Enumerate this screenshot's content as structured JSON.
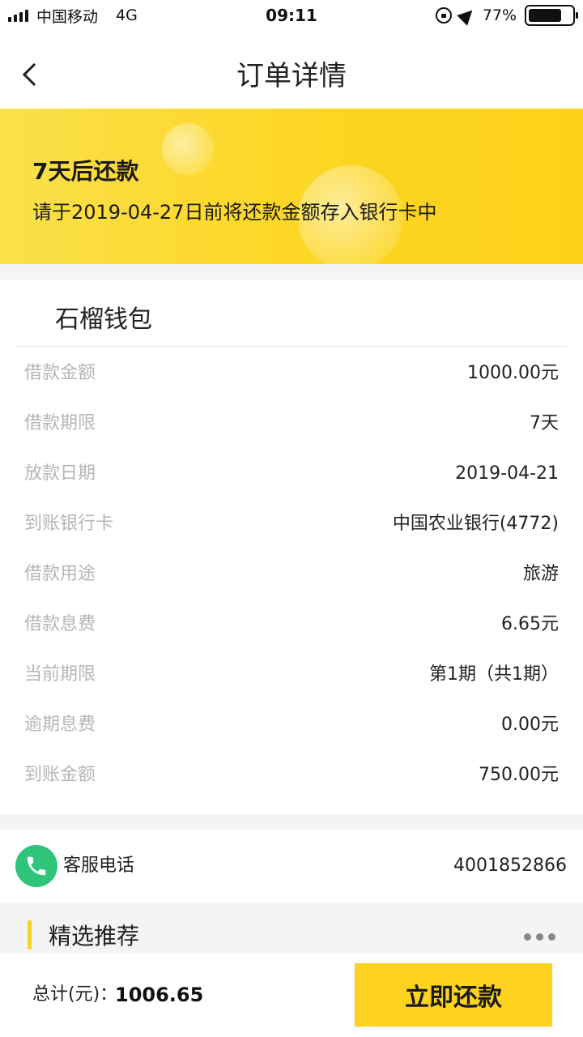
{
  "status_bar": {
    "carrier": "中国移动",
    "network": "4G",
    "time": "09:11",
    "battery": "77%",
    "battery_level": 0.77
  },
  "nav": {
    "title": "订单详情"
  },
  "banner": {
    "title": "7天后还款",
    "subtitle": "请于2019-04-27日前将还款金额存入银行卡中"
  },
  "card": {
    "title": "石榴钱包",
    "rows": [
      {
        "label": "借款金额",
        "value": "1000.00元"
      },
      {
        "label": "借款期限",
        "value": "7天"
      },
      {
        "label": "放款日期",
        "value": "2019-04-21"
      },
      {
        "label": "到账银行卡",
        "value": "中国农业银行(4772)"
      },
      {
        "label": "借款用途",
        "value": "旅游"
      },
      {
        "label": "借款息费",
        "value": "6.65元"
      },
      {
        "label": "当前期限",
        "value": "第1期（共1期）"
      },
      {
        "label": "逾期息费",
        "value": "0.00元"
      },
      {
        "label": "到账金额",
        "value": "750.00元"
      }
    ]
  },
  "service": {
    "label": "客服电话",
    "number": "4001852866"
  },
  "recommend": {
    "title": "精选推荐"
  },
  "bottom": {
    "total_label": "总计(元)：",
    "total_value": "1006.65",
    "pay_label": "立即还款"
  },
  "colors": {
    "accent": "#fdd320",
    "phone_green": "#2ec57a"
  }
}
